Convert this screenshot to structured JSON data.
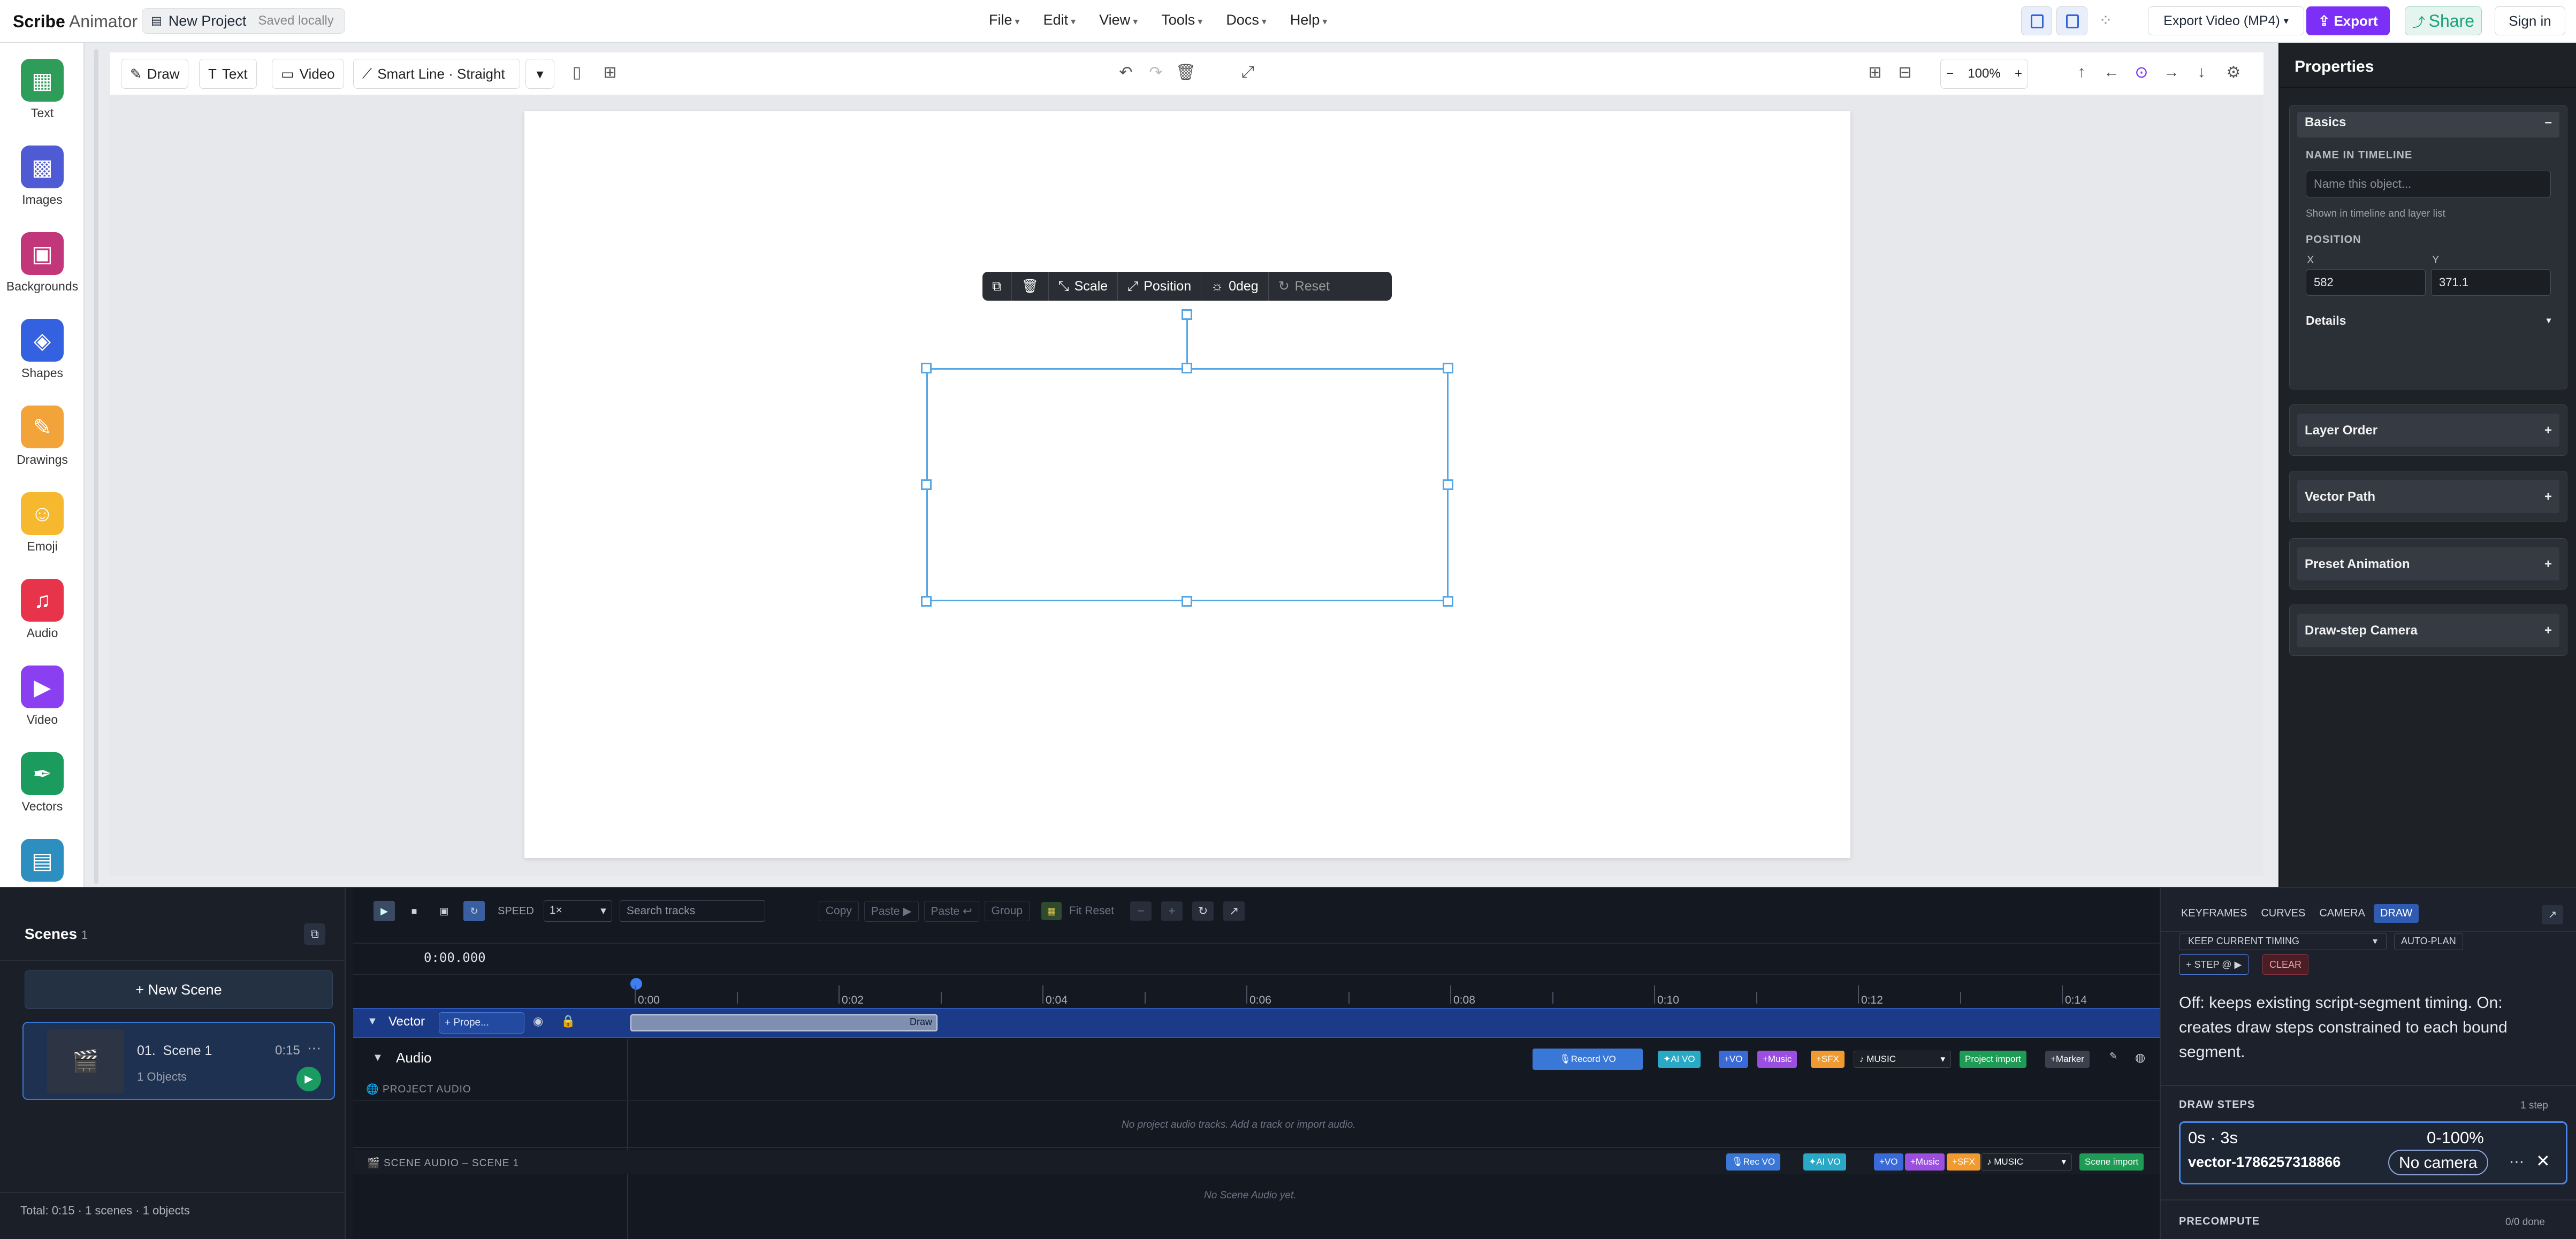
{
  "app": {
    "logo_bold": "Scribe",
    "logo_rest": "Animator",
    "project_name": "New Project",
    "saved_status": "Saved locally"
  },
  "menu": [
    "File",
    "Edit",
    "View",
    "Tools",
    "Docs",
    "Help"
  ],
  "header": {
    "export_format": "Export Video (MP4)",
    "export_label": "Export",
    "share_label": "Share",
    "signin_label": "Sign in"
  },
  "sidebar": [
    {
      "label": "Text",
      "icon": "text-icon",
      "color": "#2e9d5a"
    },
    {
      "label": "Images",
      "icon": "image-icon",
      "color": "#4f5bd5"
    },
    {
      "label": "Backgrounds",
      "icon": "background-icon",
      "color": "#c2367a"
    },
    {
      "label": "Shapes",
      "icon": "shapes-icon",
      "color": "#3461e0"
    },
    {
      "label": "Drawings",
      "icon": "palette-icon",
      "color": "#f2a33a"
    },
    {
      "label": "Emoji",
      "icon": "smile-icon",
      "color": "#f5b82e"
    },
    {
      "label": "Audio",
      "icon": "music-icon",
      "color": "#e8344a"
    },
    {
      "label": "Video",
      "icon": "video-icon",
      "color": "#8a3ff0"
    },
    {
      "label": "Vectors",
      "icon": "pen-nib-icon",
      "color": "#1c9b5e"
    },
    {
      "label": "",
      "icon": "film-icon",
      "color": "#2d8fc0"
    }
  ],
  "toolbar": {
    "draw": "Draw",
    "text": "Text",
    "video": "Video",
    "line_mode": "Smart Line · Straight",
    "zoom": "100%"
  },
  "float_toolbar": {
    "scale": "Scale",
    "position": "Position",
    "rotation": "0deg",
    "reset": "Reset"
  },
  "properties": {
    "title": "Properties",
    "basics": "Basics",
    "name_label": "NAME IN TIMELINE",
    "name_placeholder": "Name this object...",
    "name_hint": "Shown in timeline and layer list",
    "position_label": "POSITION",
    "x_label": "X",
    "y_label": "Y",
    "x_value": "582",
    "y_value": "371.1",
    "details": "Details",
    "sections": [
      "Layer Order",
      "Vector Path",
      "Preset Animation",
      "Draw-step Camera"
    ]
  },
  "scenes": {
    "title": "Scenes",
    "count": "1",
    "new_scene": "+ New Scene",
    "scene_num": "01.",
    "scene_name": "Scene 1",
    "scene_duration": "0:15",
    "scene_objects": "1 Objects",
    "footer": "Total: 0:15 · 1 scenes · 1 objects"
  },
  "timeline": {
    "speed_label": "SPEED",
    "speed_value": "1×",
    "search_placeholder": "Search tracks",
    "copy": "Copy",
    "paste1": "Paste ▶",
    "paste2": "Paste ↩",
    "group": "Group",
    "fit_reset": "Fit Reset",
    "time": "0:00.000",
    "ruler": [
      "0:00",
      "0:02",
      "0:04",
      "0:06",
      "0:08",
      "0:10",
      "0:12",
      "0:14"
    ],
    "vector_track": "Vector",
    "vector_chip": "Prope...",
    "clip_label": "Draw",
    "audio_track": "Audio",
    "record_vo": "Record VO",
    "ai_vo": "AI VO",
    "vo": "+VO",
    "music": "+Music",
    "sfx": "+SFX",
    "music_select": "MUSIC",
    "project_import": "Project import",
    "marker": "+Marker",
    "project_audio": "PROJECT AUDIO",
    "no_project_audio": "No project audio tracks. Add a track or import audio.",
    "scene_audio": "SCENE AUDIO – SCENE 1",
    "rec_vo": "Rec VO",
    "scene_import": "Scene import",
    "no_scene_audio": "No Scene Audio yet."
  },
  "drawpanel": {
    "tabs": [
      "KEYFRAMES",
      "CURVES",
      "CAMERA",
      "DRAW"
    ],
    "keep_timing": "KEEP CURRENT TIMING",
    "auto_plan": "AUTO-PLAN",
    "step_btn": "+ STEP @ ▶",
    "clear": "CLEAR",
    "help": "Off: keeps existing script-segment timing. On: creates draw steps constrained to each bound segment.",
    "draw_steps": "DRAW STEPS",
    "steps_count": "1 step",
    "step_time": "0s · 3s",
    "step_pct": "0-100%",
    "step_name": "vector-1786257318866",
    "camera": "No camera",
    "precompute": "PRECOMPUTE",
    "precompute_status": "0/0 done"
  },
  "colors": {
    "accent": "#7b2ff7",
    "share": "#1aa37a",
    "selection": "#54a6e5",
    "track": "#1d3f8f"
  }
}
